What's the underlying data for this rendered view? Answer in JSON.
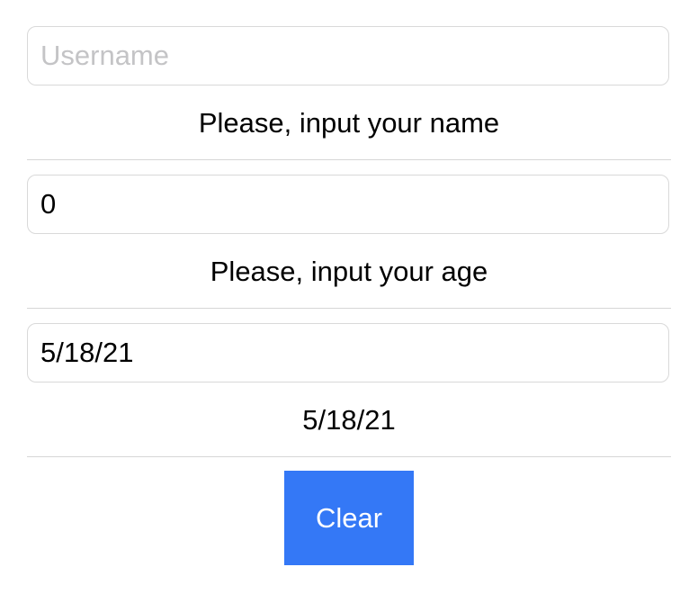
{
  "username": {
    "value": "",
    "placeholder": "Username",
    "caption": "Please, input your name"
  },
  "age": {
    "value": "0",
    "caption": "Please, input your age"
  },
  "date": {
    "value": "5/18/21",
    "caption": "5/18/21"
  },
  "clear_button": {
    "label": "Clear"
  },
  "colors": {
    "accent": "#3478f6",
    "placeholder": "#c4c4c6",
    "border": "#d9d9d9",
    "divider": "#d6d6d6"
  }
}
